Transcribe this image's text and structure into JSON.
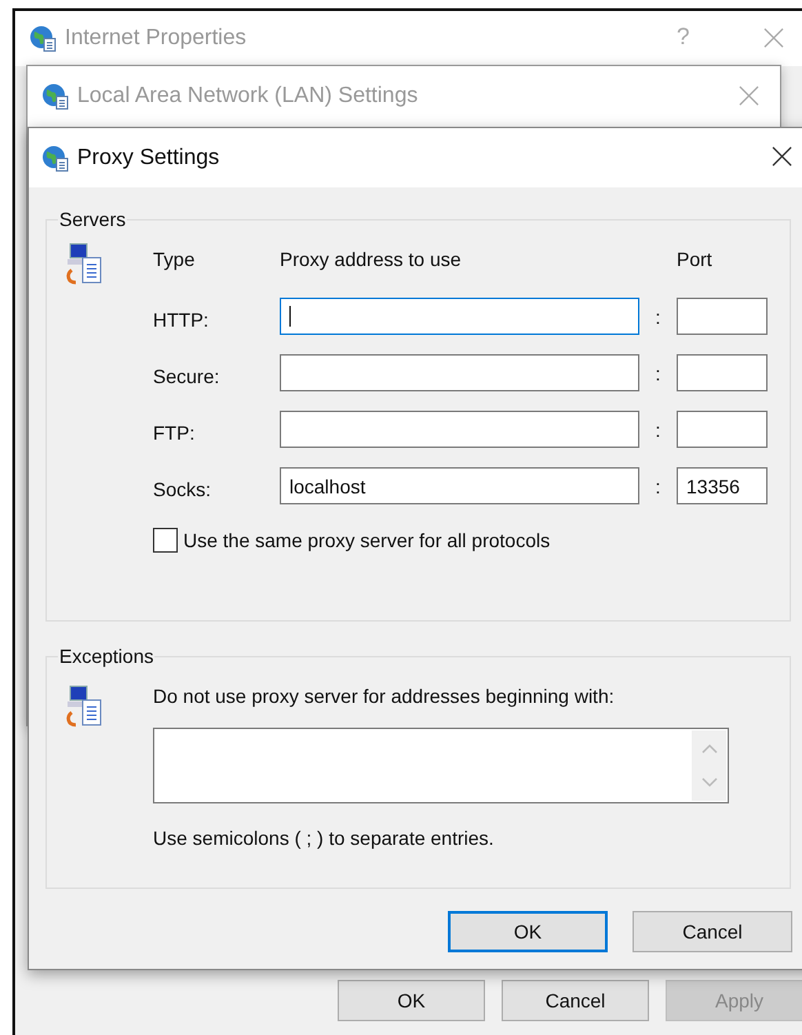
{
  "windows": [
    {
      "title": "Internet Properties",
      "help": "?"
    },
    {
      "title": "Local Area Network (LAN) Settings"
    }
  ],
  "dialog": {
    "title": "Proxy Settings",
    "servers": {
      "label": "Servers",
      "headers": [
        "Type",
        "Proxy address to use",
        "Port"
      ],
      "rows": [
        {
          "type": "HTTP:",
          "address": "",
          "port": "",
          "focused": true
        },
        {
          "type": "Secure:",
          "address": "",
          "port": "",
          "focused": false
        },
        {
          "type": "FTP:",
          "address": "",
          "port": "",
          "focused": false
        },
        {
          "type": "Socks:",
          "address": "localhost",
          "port": "13356",
          "focused": false
        }
      ],
      "separator": ":",
      "same_proxy": {
        "label": "Use the same proxy server for all protocols",
        "checked": false
      }
    },
    "exceptions": {
      "label": "Exceptions",
      "description": "Do not use proxy server for addresses beginning with:",
      "note": "Use semicolons ( ; ) to separate entries."
    },
    "buttons": [
      {
        "label": "OK",
        "default": true
      },
      {
        "label": "Cancel",
        "default": false
      }
    ]
  },
  "outer_buttons": [
    {
      "label": "OK",
      "disabled": false
    },
    {
      "label": "Cancel",
      "disabled": false
    },
    {
      "label": "Apply",
      "disabled": true
    }
  ]
}
